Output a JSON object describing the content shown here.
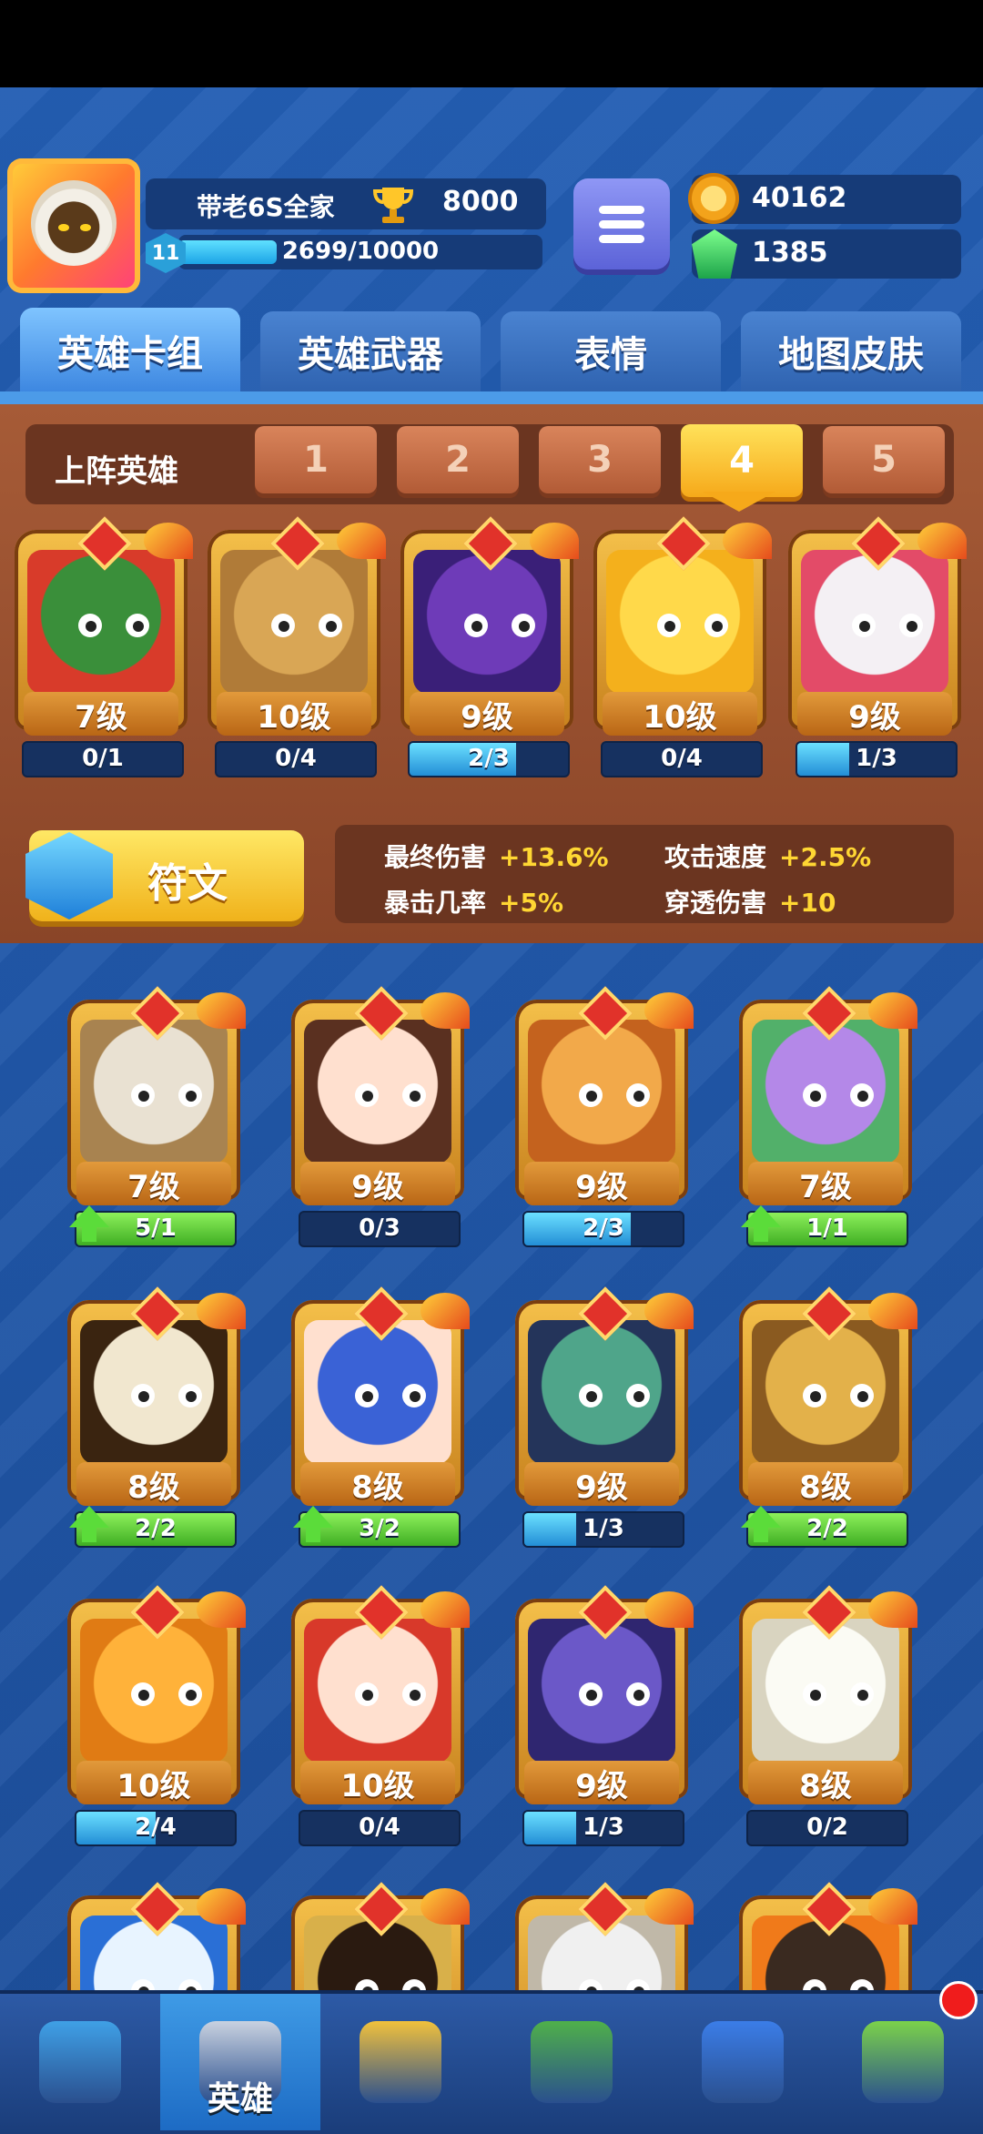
{
  "header": {
    "player_name": "带老6S全家",
    "trophies": "8000",
    "player_level": "11",
    "xp": "2699/10000",
    "xp_fraction": 0.27,
    "coins": "40162",
    "gems": "1385"
  },
  "tabs": [
    {
      "label": "英雄卡组"
    },
    {
      "label": "英雄武器"
    },
    {
      "label": "表情"
    },
    {
      "label": "地图皮肤"
    }
  ],
  "deck": {
    "title": "上阵英雄",
    "slots": [
      "1",
      "2",
      "3",
      "4",
      "5"
    ],
    "active_slot": "4",
    "heroes": [
      {
        "level": "7级",
        "progress": "0/1",
        "fill": 0,
        "colors": [
          "#3a8f3a",
          "#d83b2a"
        ]
      },
      {
        "level": "10级",
        "progress": "0/4",
        "fill": 0,
        "colors": [
          "#d9a655",
          "#b07b38"
        ]
      },
      {
        "level": "9级",
        "progress": "2/3",
        "fill": 0.67,
        "colors": [
          "#6e3bb8",
          "#3a1f78"
        ]
      },
      {
        "level": "10级",
        "progress": "0/4",
        "fill": 0,
        "colors": [
          "#ffd94a",
          "#f4b01c"
        ]
      },
      {
        "level": "9级",
        "progress": "1/3",
        "fill": 0.33,
        "colors": [
          "#f4f0f4",
          "#e34b68"
        ]
      }
    ]
  },
  "rune": {
    "label": "符文"
  },
  "stats": [
    {
      "label": "最终伤害",
      "value": "+13.6%"
    },
    {
      "label": "攻击速度",
      "value": "+2.5%"
    },
    {
      "label": "暴击几率",
      "value": "+5%"
    },
    {
      "label": "穿透伤害",
      "value": "+10"
    }
  ],
  "collection": [
    {
      "level": "7级",
      "progress": "5/1",
      "fill": 1,
      "upgrade": true,
      "colors": [
        "#e9e1d2",
        "#a88350"
      ]
    },
    {
      "level": "9级",
      "progress": "0/3",
      "fill": 0,
      "upgrade": false,
      "colors": [
        "#ffe0cf",
        "#5a3020"
      ]
    },
    {
      "level": "9级",
      "progress": "2/3",
      "fill": 0.67,
      "upgrade": false,
      "colors": [
        "#f2a94a",
        "#c4621e"
      ]
    },
    {
      "level": "7级",
      "progress": "1/1",
      "fill": 1,
      "upgrade": true,
      "colors": [
        "#b488e8",
        "#52b06a"
      ]
    },
    {
      "level": "8级",
      "progress": "2/2",
      "fill": 1,
      "upgrade": true,
      "colors": [
        "#f1e7cf",
        "#3a2410"
      ]
    },
    {
      "level": "8级",
      "progress": "3/2",
      "fill": 1,
      "upgrade": true,
      "colors": [
        "#3a62d6",
        "#ffe0cf"
      ]
    },
    {
      "level": "9级",
      "progress": "1/3",
      "fill": 0.33,
      "upgrade": false,
      "colors": [
        "#4fa58a",
        "#24345a"
      ]
    },
    {
      "level": "8级",
      "progress": "2/2",
      "fill": 1,
      "upgrade": true,
      "colors": [
        "#e3b14a",
        "#8a5a20"
      ]
    },
    {
      "level": "10级",
      "progress": "2/4",
      "fill": 0.5,
      "upgrade": false,
      "colors": [
        "#ffb23a",
        "#e07b14"
      ]
    },
    {
      "level": "10级",
      "progress": "0/4",
      "fill": 0,
      "upgrade": false,
      "colors": [
        "#ffe0cf",
        "#d8392a"
      ]
    },
    {
      "level": "9级",
      "progress": "1/3",
      "fill": 0.33,
      "upgrade": false,
      "colors": [
        "#6b58c8",
        "#2f2670"
      ]
    },
    {
      "level": "8级",
      "progress": "0/2",
      "fill": 0,
      "upgrade": false,
      "colors": [
        "#fbfbf4",
        "#d9d4c0"
      ]
    },
    {
      "level": "",
      "progress": "",
      "fill": 0,
      "upgrade": false,
      "colors": [
        "#e8f4ff",
        "#2a6fd6"
      ]
    },
    {
      "level": "",
      "progress": "",
      "fill": 0,
      "upgrade": false,
      "colors": [
        "#2a1a10",
        "#d8b04a"
      ]
    },
    {
      "level": "",
      "progress": "",
      "fill": 0,
      "upgrade": false,
      "colors": [
        "#f0f0f0",
        "#c0b8a8"
      ]
    },
    {
      "level": "",
      "progress": "",
      "fill": 0,
      "upgrade": false,
      "colors": [
        "#3a2a20",
        "#f07a1a"
      ]
    }
  ],
  "nav": [
    {
      "icon": "treasure-chest-icon",
      "label": ""
    },
    {
      "icon": "knight-helmet-icon",
      "label": "英雄"
    },
    {
      "icon": "crossed-swords-icon",
      "label": ""
    },
    {
      "icon": "crown-shield-icon",
      "label": ""
    },
    {
      "icon": "team-banner-icon",
      "label": ""
    },
    {
      "icon": "sprout-island-icon",
      "label": ""
    }
  ]
}
